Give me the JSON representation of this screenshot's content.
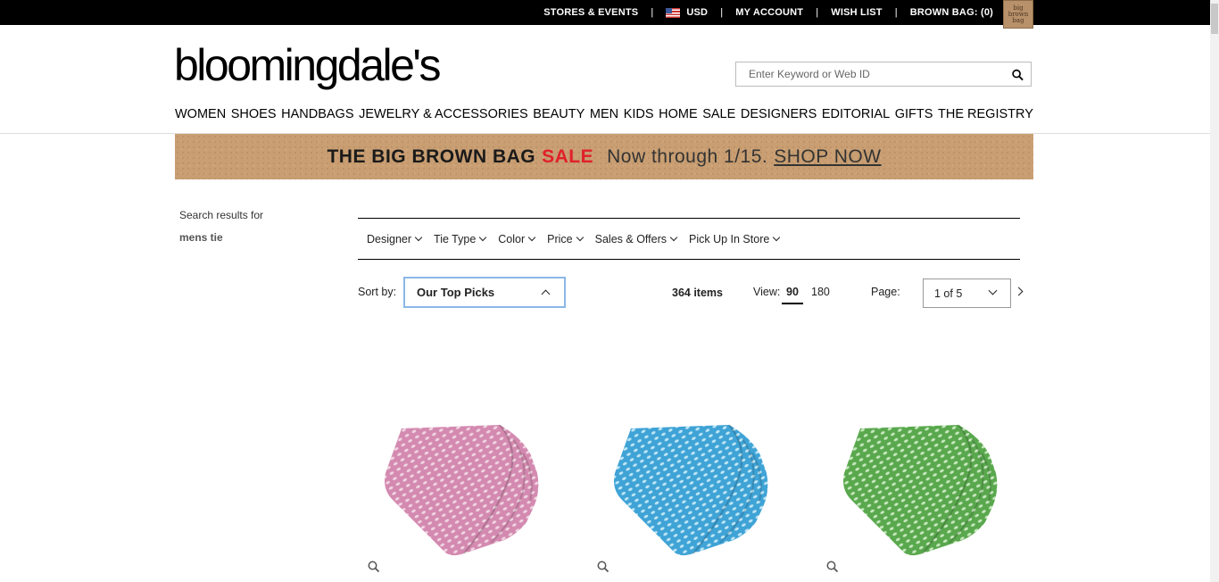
{
  "topbar": {
    "stores_events": "STORES & EVENTS",
    "currency": "USD",
    "my_account": "MY ACCOUNT",
    "wish_list": "WISH LIST",
    "brown_bag": "BROWN BAG: (0)",
    "bag_icon_text": "big brown bag"
  },
  "header": {
    "logo": "bloomingdale's",
    "search_placeholder": "Enter Keyword or Web ID"
  },
  "nav": {
    "items": [
      "WOMEN",
      "SHOES",
      "HANDBAGS",
      "JEWELRY & ACCESSORIES",
      "BEAUTY",
      "MEN",
      "KIDS",
      "HOME",
      "SALE",
      "DESIGNERS",
      "EDITORIAL",
      "GIFTS",
      "THE REGISTRY"
    ]
  },
  "banner": {
    "part1": "THE BIG BROWN BAG",
    "part2": "SALE",
    "part3": "Now through 1/15.",
    "cta": "SHOP NOW"
  },
  "search": {
    "results_for": "Search results for",
    "term": "mens tie"
  },
  "filters": [
    "Designer",
    "Tie Type",
    "Color",
    "Price",
    "Sales & Offers",
    "Pick Up In Store"
  ],
  "sort": {
    "label": "Sort by:",
    "selected": "Our Top Picks"
  },
  "results": {
    "count": "364 items",
    "view_label": "View:",
    "view_options": [
      "90",
      "180"
    ],
    "page_label": "Page:",
    "page_selected": "1 of 5"
  },
  "products": [
    {
      "color": "#d48ab0",
      "pattern": "#f0d4e2"
    },
    {
      "color": "#3fa3d6",
      "pattern": "#bfe6f5"
    },
    {
      "color": "#5aa84e",
      "pattern": "#c6e8bd"
    }
  ],
  "icons": [
    "flag-us-icon",
    "search-icon",
    "chevron-down-icon",
    "chevron-up-icon",
    "chevron-right-icon",
    "zoom-icon"
  ]
}
